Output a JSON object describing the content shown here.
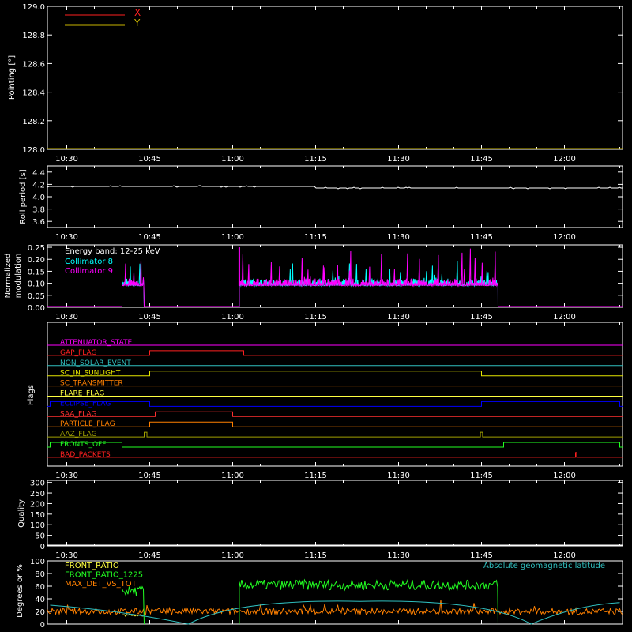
{
  "time_ticks": [
    "10:30",
    "10:45",
    "11:00",
    "11:15",
    "11:30",
    "11:45",
    "12:00"
  ],
  "time_ticks_min": [
    630,
    645,
    660,
    675,
    690,
    705,
    720
  ],
  "time_range_min": [
    626.5,
    730.5
  ],
  "colors": {
    "red": "#ff2020",
    "yellow": "#c8b400",
    "white": "#ffffff",
    "cyan": "#00ffff",
    "magenta": "#ff00ff",
    "green": "#22ff22",
    "orange": "#ff8000",
    "blue": "#0000ff",
    "olive": "#a0a000",
    "aqua": "#30c0c0"
  },
  "panels": {
    "pointing": {
      "ylabel": "Pointing [°]",
      "yticks": [
        "129.0",
        "128.8",
        "128.6",
        "128.4",
        "128.2",
        "128.0"
      ],
      "ylim": [
        128.0,
        129.0
      ],
      "legend": [
        {
          "name": "X",
          "color": "#ff2020"
        },
        {
          "name": "Y",
          "color": "#c8b400"
        }
      ]
    },
    "roll": {
      "ylabel": "Roll period [s]",
      "yticks": [
        "4.4",
        "4.2",
        "4.0",
        "3.8",
        "3.6"
      ],
      "ylim": [
        3.5,
        4.5
      ]
    },
    "modulation": {
      "ylabel_line1": "Normalized",
      "ylabel_line2": "modulation",
      "yticks": [
        "0.25",
        "0.20",
        "0.15",
        "0.10",
        "0.05",
        "0.00"
      ],
      "ylim": [
        0.0,
        0.26
      ],
      "legend_title": "Energy band: 12-25 keV",
      "legend": [
        {
          "name": "Collimator 8",
          "color": "#00ffff"
        },
        {
          "name": "Collimator 9",
          "color": "#ff00ff"
        }
      ]
    },
    "flags": {
      "ylabel": "Flags",
      "items": [
        {
          "label": "ATTENUATOR_STATE",
          "color": "#ff00ff"
        },
        {
          "label": "GAP_FLAG",
          "color": "#ff2020"
        },
        {
          "label": "NON_SOLAR_EVENT",
          "color": "#30c0c0"
        },
        {
          "label": "SC_IN_SUNLIGHT",
          "color": "#e6e600"
        },
        {
          "label": "SC_TRANSMITTER",
          "color": "#ff8000"
        },
        {
          "label": "FLARE_FLAG",
          "color": "#ffff40"
        },
        {
          "label": "ECLIPSE_FLAG",
          "color": "#0000ff"
        },
        {
          "label": "SAA_FLAG",
          "color": "#ff3030"
        },
        {
          "label": "PARTICLE_FLAG",
          "color": "#ff8000"
        },
        {
          "label": "AAZ_FLAG",
          "color": "#a0a000"
        },
        {
          "label": "FRONTS_OFF",
          "color": "#22ff22"
        },
        {
          "label": "BAD_PACKETS",
          "color": "#ff2020"
        }
      ]
    },
    "quality": {
      "ylabel": "Quality",
      "yticks": [
        "300",
        "250",
        "200",
        "150",
        "100",
        "50",
        "0"
      ],
      "ylim": [
        0,
        310
      ]
    },
    "geo": {
      "ylabel": "Degrees or %",
      "yticks": [
        "100",
        "80",
        "60",
        "40",
        "20",
        "0"
      ],
      "ylim": [
        0,
        100
      ],
      "legend": [
        {
          "name": "FRONT_RATIO",
          "color": "#ffff40"
        },
        {
          "name": "FRONT_RATIO_1225",
          "color": "#22ff22"
        },
        {
          "name": "MAX_DET_VS_TOT",
          "color": "#ff8000"
        }
      ],
      "right_label": "Absolute geomagnetic latitude",
      "right_label_color": "#30c0c0"
    }
  },
  "chart_data": [
    {
      "type": "line",
      "title": "",
      "ylabel": "Pointing [°]",
      "ylim": [
        128.0,
        129.0
      ],
      "series": [
        {
          "name": "X",
          "x": [],
          "y": []
        },
        {
          "name": "Y",
          "x": [],
          "y": []
        }
      ]
    },
    {
      "type": "line",
      "ylabel": "Roll period [s]",
      "ylim": [
        3.5,
        4.5
      ],
      "series": [
        {
          "x": [
            "10:27",
            "11:08",
            "11:09",
            "12:10"
          ],
          "y": [
            4.14,
            4.14,
            4.12,
            4.12
          ]
        }
      ]
    },
    {
      "type": "line",
      "ylabel": "Normalized modulation",
      "ylim": [
        0.0,
        0.26
      ],
      "series": [
        {
          "name": "Collimator 8",
          "segments": [
            [
              "10:40",
              "10:44"
            ],
            [
              "11:01",
              "11:48"
            ]
          ],
          "baseline": 0.09,
          "max": 0.2
        },
        {
          "name": "Collimator 9",
          "segments": [
            [
              "10:40",
              "10:44"
            ],
            [
              "11:01",
              "11:48"
            ]
          ],
          "baseline": 0.09,
          "max": 0.25
        }
      ]
    },
    {
      "type": "line",
      "ylabel": "Flags",
      "series": [
        {
          "name": "ATTENUATOR_STATE",
          "high": []
        },
        {
          "name": "GAP_FLAG",
          "high": [
            [
              "10:45",
              "11:02"
            ]
          ]
        },
        {
          "name": "NON_SOLAR_EVENT",
          "high": []
        },
        {
          "name": "SC_IN_SUNLIGHT",
          "high": [
            [
              "10:45",
              "11:45"
            ]
          ]
        },
        {
          "name": "SC_TRANSMITTER",
          "high": []
        },
        {
          "name": "FLARE_FLAG",
          "high": []
        },
        {
          "name": "ECLIPSE_FLAG",
          "high": [
            [
              "10:27",
              "10:45"
            ],
            [
              "11:45",
              "12:10"
            ]
          ]
        },
        {
          "name": "SAA_FLAG",
          "high": [
            [
              "10:46",
              "11:00"
            ]
          ]
        },
        {
          "name": "PARTICLE_FLAG",
          "high": [
            [
              "10:45",
              "11:00"
            ]
          ]
        },
        {
          "name": "AAZ_FLAG",
          "high": [
            [
              "10:44",
              "10:44.5"
            ],
            [
              "11:44.8",
              "11:45.2"
            ]
          ]
        },
        {
          "name": "FRONTS_OFF",
          "high": [
            [
              "10:27",
              "10:40"
            ],
            [
              "11:49",
              "12:10"
            ]
          ]
        },
        {
          "name": "BAD_PACKETS",
          "high": [
            [
              "12:02",
              "12:02.2"
            ]
          ]
        }
      ]
    },
    {
      "type": "line",
      "ylabel": "Quality",
      "ylim": [
        0,
        310
      ],
      "series": [
        {
          "x": [
            "10:27",
            "12:10"
          ],
          "y": [
            0,
            0
          ]
        }
      ]
    },
    {
      "type": "line",
      "ylabel": "Degrees or %",
      "ylim": [
        0,
        100
      ],
      "series": [
        {
          "name": "FRONT_RATIO",
          "segments": [
            [
              "10:40",
              "10:44"
            ]
          ],
          "level": 12
        },
        {
          "name": "FRONT_RATIO_1225",
          "segments": [
            [
              "10:40",
              "10:44"
            ],
            [
              "11:01",
              "11:48"
            ]
          ],
          "level": 62
        },
        {
          "name": "MAX_DET_VS_TOT",
          "level": 18
        },
        {
          "name": "Absolute geomagnetic latitude",
          "x": [
            "10:27",
            "10:52",
            "11:23",
            "11:54",
            "12:10"
          ],
          "y": [
            30,
            0,
            36,
            0,
            34
          ]
        }
      ]
    }
  ]
}
